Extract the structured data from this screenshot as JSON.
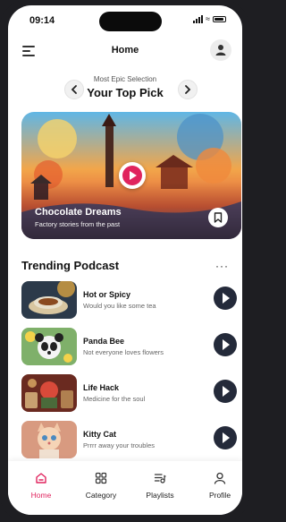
{
  "status_bar": {
    "time": "09:14"
  },
  "header": {
    "title": "Home"
  },
  "pick": {
    "subtitle": "Most Epic Selection",
    "title": "Your Top Pick"
  },
  "hero": {
    "title": "Chocolate Dreams",
    "subtitle": "Factory stories from the past"
  },
  "trending": {
    "title": "Trending Podcast",
    "items": [
      {
        "title": "Hot or Spicy",
        "subtitle": "Would you like some tea"
      },
      {
        "title": "Panda Bee",
        "subtitle": "Not everyone loves flowers"
      },
      {
        "title": "Life Hack",
        "subtitle": "Medicine for the soul"
      },
      {
        "title": "Kitty Cat",
        "subtitle": "Prrrr away your troubles"
      }
    ]
  },
  "tabs": [
    {
      "label": "Home",
      "active": true
    },
    {
      "label": "Category",
      "active": false
    },
    {
      "label": "Playlists",
      "active": false
    },
    {
      "label": "Profile",
      "active": false
    }
  ],
  "colors": {
    "accent": "#e0245e",
    "play_button": "#242a3a"
  },
  "icons": [
    "menu-icon",
    "user-icon",
    "chevron-left-icon",
    "chevron-right-icon",
    "play-icon",
    "bookmark-icon",
    "more-icon",
    "home-icon",
    "grid-icon",
    "playlist-icon",
    "person-icon"
  ]
}
